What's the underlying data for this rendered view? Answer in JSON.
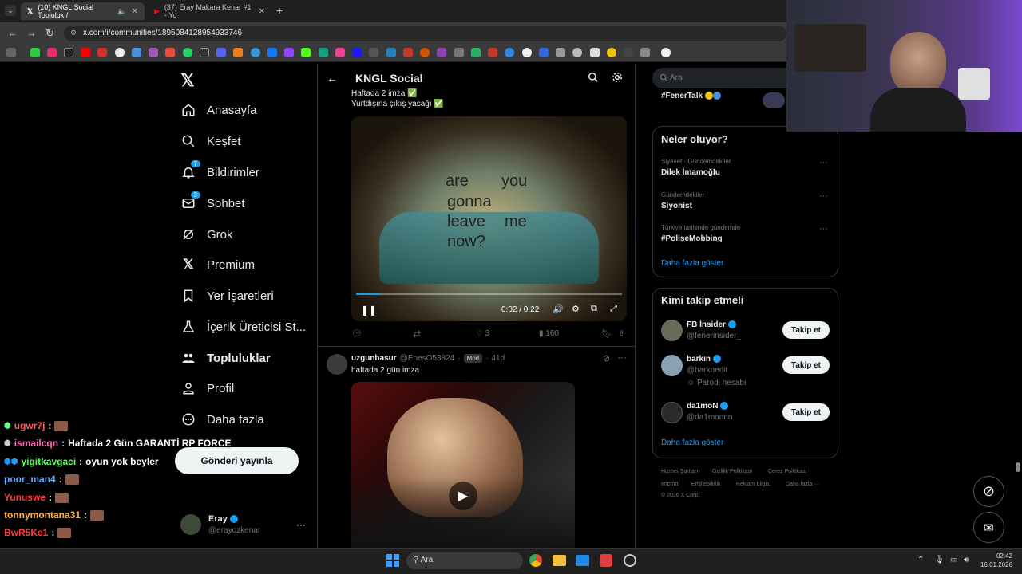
{
  "browser": {
    "tabs": [
      {
        "label": "(10) KNGL Social Topluluk /"
      },
      {
        "label": "(37) Eray Makara Kenar #1 - Yo"
      }
    ],
    "new_tab": "+",
    "url": "x.com/i/communities/1895084128954933746"
  },
  "sidebar": {
    "items": [
      {
        "label": "Anasayfa",
        "icon": "home-icon"
      },
      {
        "label": "Keşfet",
        "icon": "search-icon"
      },
      {
        "label": "Bildirimler",
        "icon": "bell-icon",
        "badge": "7"
      },
      {
        "label": "Sohbet",
        "icon": "mail-icon",
        "badge": "3"
      },
      {
        "label": "Grok",
        "icon": "grok-icon"
      },
      {
        "label": "Premium",
        "icon": "x-icon"
      },
      {
        "label": "Yer İşaretleri",
        "icon": "bookmark-icon"
      },
      {
        "label": "İçerik Üreticisi St...",
        "icon": "creator-icon"
      },
      {
        "label": "Topluluklar",
        "icon": "communities-icon"
      },
      {
        "label": "Profil",
        "icon": "person-icon"
      },
      {
        "label": "Daha fazla",
        "icon": "more-circle-icon"
      }
    ],
    "post_button": "Gönderi yayınla",
    "account": {
      "name": "Eray",
      "handle": "@erayozkenar",
      "more": "···"
    }
  },
  "header": {
    "title": "KNGL Social"
  },
  "post1": {
    "text_line1": "Haftada 2 imza ✅",
    "text_line2": "Yurtdışına çıkış yasağı ✅",
    "video_caption": [
      "are",
      "you",
      "gonna",
      "leave",
      "me",
      "now?"
    ],
    "time": "0:02 / 0:22",
    "progress": 0.09,
    "likes": "3",
    "views": "160"
  },
  "post2": {
    "name": "uzgunbasur",
    "handle": "@EnesO53824",
    "badge": "Mod",
    "age": "41d",
    "text": "haftada 2 gün imza"
  },
  "right": {
    "search_placeholder": "Ara",
    "fener_tag": "#FenerTalk",
    "trends_title": "Neler oluyor?",
    "trends": [
      {
        "meta": "Siyaset · Gündemdekiler",
        "name": "Dilek İmamoğlu"
      },
      {
        "meta": "Gündemdekiler",
        "name": "Siyonist"
      },
      {
        "meta": "Türkiye tarihinde gündemde",
        "name": "#PoliseMobbing"
      }
    ],
    "show_more": "Daha fazla göster",
    "follow_title": "Kimi takip etmeli",
    "follow": [
      {
        "name": "FB İnsider",
        "handle": "@fenerinsider_",
        "extra": "",
        "button": "Takip et"
      },
      {
        "name": "barkın",
        "handle": "@barknedit",
        "extra": "Parodi hesabı",
        "button": "Takip et"
      },
      {
        "name": "da1moN",
        "handle": "@da1monnn",
        "extra": "",
        "button": "Takip et"
      }
    ],
    "footer": [
      "Hizmet Şartları",
      "Gizlilik Politikası",
      "Çerez Politikası",
      "Imprint",
      "Erişilebilirlik",
      "Reklam bilgisi",
      "Daha fazla ···",
      "© 2026 X Corp."
    ]
  },
  "chat": [
    {
      "user": "ugwr7j",
      "msg": "",
      "color": "#ff5a5a"
    },
    {
      "user": "ismailcqn",
      "msg": "Haftada 2 Gün GARANTİ RP FORCE",
      "color": "#ff69b4"
    },
    {
      "user": "yigitkavgaci",
      "msg": "oyun yok beyler",
      "color": "#5fff5f"
    },
    {
      "user": "poor_man4",
      "msg": "",
      "color": "#6aa5ff"
    },
    {
      "user": "Yunuswe",
      "msg": "",
      "color": "#ff3b3b"
    },
    {
      "user": "tonnymontana31",
      "msg": "",
      "color": "#ffb347"
    },
    {
      "user": "BwR5Ke1",
      "msg": "",
      "color": "#ff3b3b"
    }
  ],
  "taskbar": {
    "search": "Ara",
    "time": "02:42",
    "date": "16.01.2026"
  }
}
